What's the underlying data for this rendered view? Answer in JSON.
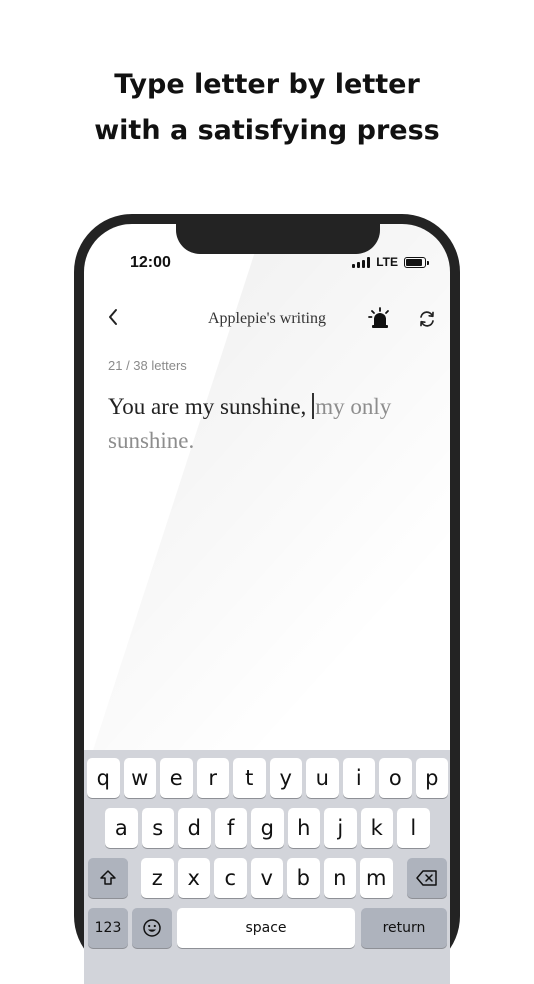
{
  "headline": {
    "line1": "Type letter by letter",
    "line2": "with a satisfying press"
  },
  "status_bar": {
    "time": "12:00",
    "network": "LTE"
  },
  "nav": {
    "title": "Applepie's writing"
  },
  "editor": {
    "counter": "21 / 38 letters",
    "typed_text": "You are my sunshine,",
    "remaining_text": "my only sunshine.",
    "typed_count": 21,
    "total_count": 38
  },
  "keyboard": {
    "row1": [
      "q",
      "w",
      "e",
      "r",
      "t",
      "y",
      "u",
      "i",
      "o",
      "p"
    ],
    "row2": [
      "a",
      "s",
      "d",
      "f",
      "g",
      "h",
      "j",
      "k",
      "l"
    ],
    "row3": [
      "z",
      "x",
      "c",
      "v",
      "b",
      "n",
      "m"
    ],
    "numbers_label": "123",
    "space_label": "space",
    "return_label": "return"
  },
  "icons": {
    "back": "chevron-left-icon",
    "alarm": "alarm-siren-icon",
    "refresh": "refresh-icon",
    "shift": "shift-icon",
    "delete": "backspace-icon",
    "emoji": "emoji-icon"
  },
  "colors": {
    "phone_frame": "#232323",
    "keyboard_bg": "#d2d4da",
    "remaining_text": "#8d8d8d"
  }
}
